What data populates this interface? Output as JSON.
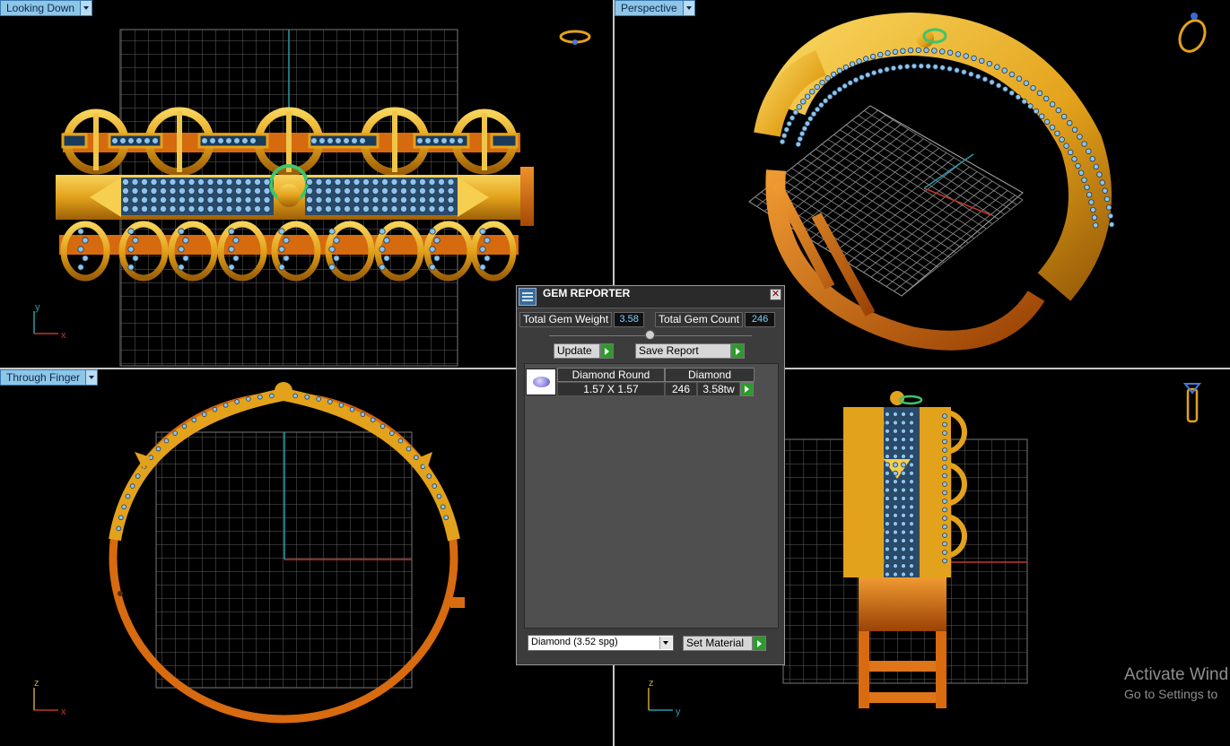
{
  "viewports": {
    "top_left": {
      "label": "Looking Down",
      "axes": [
        "y",
        "x"
      ]
    },
    "top_right": {
      "label": "Perspective"
    },
    "bottom_left": {
      "label": "Through Finger",
      "axes": [
        "z",
        "x"
      ]
    },
    "bottom_right": {
      "axes": [
        "z",
        "y"
      ]
    }
  },
  "gem_reporter": {
    "title": "GEM REPORTER",
    "close_glyph": "✕",
    "total_gem_weight_label": "Total Gem Weight",
    "total_gem_weight": "3.58",
    "total_gem_count_label": "Total Gem Count",
    "total_gem_count": "246",
    "update_label": "Update",
    "save_report_label": "Save Report",
    "columns": {
      "cut": "Diamond Round",
      "material": "Diamond"
    },
    "rows": [
      {
        "size": "1.57 X 1.57",
        "count": "246",
        "weight": "3.58tw"
      }
    ],
    "material_select": "Diamond     (3.52 spg)",
    "set_material_label": "Set Material"
  },
  "watermark": {
    "line1": "Activate Wind",
    "line2": "Go to Settings to"
  },
  "colors": {
    "gold": "#e6a21a",
    "copper": "#d96b0c",
    "gem": "#8fc3ea",
    "grid": "#6a6a6a"
  }
}
